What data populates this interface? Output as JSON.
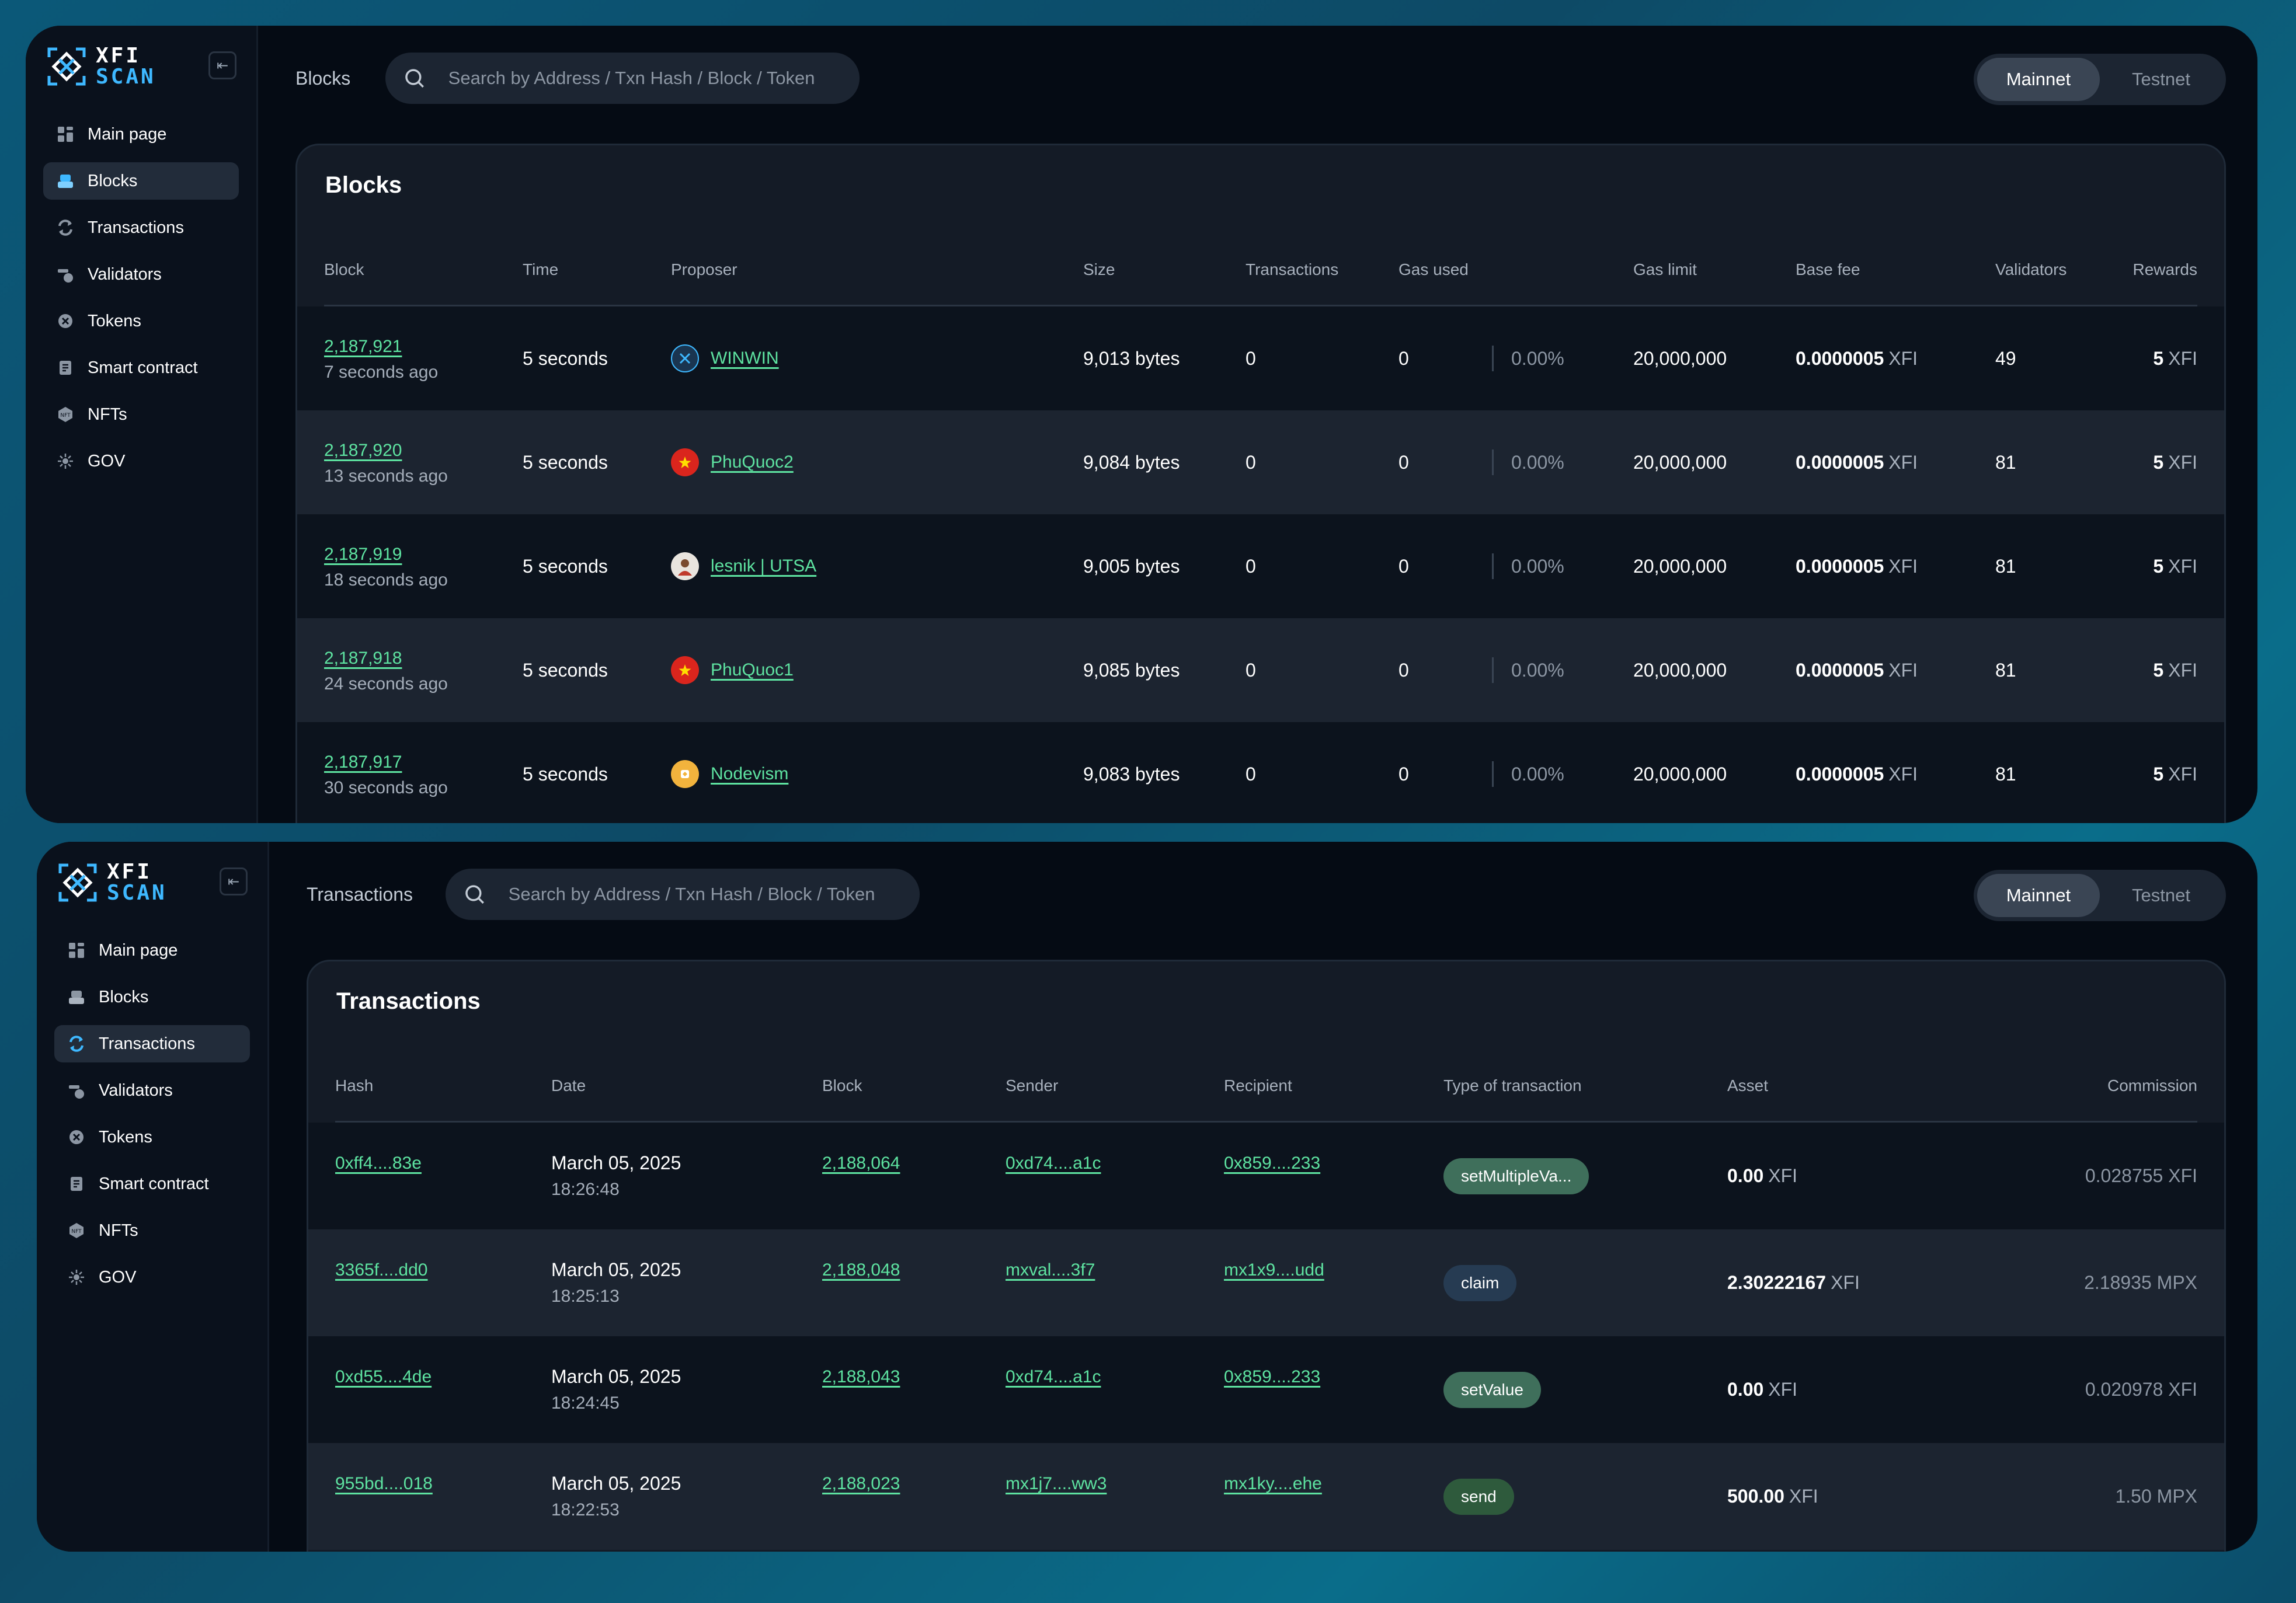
{
  "brand": {
    "line1": "XFI",
    "line2": "SCAN",
    "accent": "#3eb8ff",
    "link_color": "#5ee3a1"
  },
  "sidebar": {
    "items": [
      {
        "label": "Main page",
        "icon": "dashboard-icon"
      },
      {
        "label": "Blocks",
        "icon": "blocks-icon"
      },
      {
        "label": "Transactions",
        "icon": "transactions-icon"
      },
      {
        "label": "Validators",
        "icon": "validators-icon"
      },
      {
        "label": "Tokens",
        "icon": "tokens-icon"
      },
      {
        "label": "Smart contract",
        "icon": "contract-icon"
      },
      {
        "label": "NFTs",
        "icon": "nft-icon"
      },
      {
        "label": "GOV",
        "icon": "gov-icon"
      }
    ]
  },
  "search": {
    "placeholder": "Search by Address / Txn Hash / Block / Token"
  },
  "network": {
    "mainnet": "Mainnet",
    "testnet": "Testnet",
    "selected": "Mainnet"
  },
  "blocks_page": {
    "crumb": "Blocks",
    "title": "Blocks",
    "columns": [
      "Block",
      "Time",
      "Proposer",
      "Size",
      "Transactions",
      "Gas used",
      "Gas limit",
      "Base fee",
      "Validators",
      "Rewards"
    ],
    "rows": [
      {
        "block": "2,187,921",
        "ago": "7 seconds ago",
        "time": "5 seconds",
        "proposer": "WINWIN",
        "size": "9,013 bytes",
        "txs": "0",
        "gas_used": "0",
        "gas_pct": "0.00%",
        "gas_limit": "20,000,000",
        "base_fee": "0.0000005",
        "fee_unit": "XFI",
        "validators": "49",
        "reward": "5",
        "reward_unit": "XFI"
      },
      {
        "block": "2,187,920",
        "ago": "13 seconds ago",
        "time": "5 seconds",
        "proposer": "PhuQuoc2",
        "size": "9,084 bytes",
        "txs": "0",
        "gas_used": "0",
        "gas_pct": "0.00%",
        "gas_limit": "20,000,000",
        "base_fee": "0.0000005",
        "fee_unit": "XFI",
        "validators": "81",
        "reward": "5",
        "reward_unit": "XFI"
      },
      {
        "block": "2,187,919",
        "ago": "18 seconds ago",
        "time": "5 seconds",
        "proposer": "lesnik | UTSA",
        "size": "9,005 bytes",
        "txs": "0",
        "gas_used": "0",
        "gas_pct": "0.00%",
        "gas_limit": "20,000,000",
        "base_fee": "0.0000005",
        "fee_unit": "XFI",
        "validators": "81",
        "reward": "5",
        "reward_unit": "XFI"
      },
      {
        "block": "2,187,918",
        "ago": "24 seconds ago",
        "time": "5 seconds",
        "proposer": "PhuQuoc1",
        "size": "9,085 bytes",
        "txs": "0",
        "gas_used": "0",
        "gas_pct": "0.00%",
        "gas_limit": "20,000,000",
        "base_fee": "0.0000005",
        "fee_unit": "XFI",
        "validators": "81",
        "reward": "5",
        "reward_unit": "XFI"
      },
      {
        "block": "2,187,917",
        "ago": "30 seconds ago",
        "time": "5 seconds",
        "proposer": "Nodevism",
        "size": "9,083 bytes",
        "txs": "0",
        "gas_used": "0",
        "gas_pct": "0.00%",
        "gas_limit": "20,000,000",
        "base_fee": "0.0000005",
        "fee_unit": "XFI",
        "validators": "81",
        "reward": "5",
        "reward_unit": "XFI"
      }
    ]
  },
  "transactions_page": {
    "crumb": "Transactions",
    "title": "Transactions",
    "columns": [
      "Hash",
      "Date",
      "Block",
      "Sender",
      "Recipient",
      "Type of transaction",
      "Asset",
      "Commission"
    ],
    "rows": [
      {
        "hash": "0xff4....83e",
        "date": "March 05, 2025",
        "clock": "18:26:48",
        "block": "2,188,064",
        "sender": "0xd74....a1c",
        "recipient": "0x859....233",
        "type": "setMultipleVa...",
        "asset": "0.00",
        "asset_unit": "XFI",
        "commission": "0.028755 XFI"
      },
      {
        "hash": "3365f....dd0",
        "date": "March 05, 2025",
        "clock": "18:25:13",
        "block": "2,188,048",
        "sender": "mxval....3f7",
        "recipient": "mx1x9....udd",
        "type": "claim",
        "asset": "2.30222167",
        "asset_unit": "XFI",
        "commission": "2.18935 MPX"
      },
      {
        "hash": "0xd55....4de",
        "date": "March 05, 2025",
        "clock": "18:24:45",
        "block": "2,188,043",
        "sender": "0xd74....a1c",
        "recipient": "0x859....233",
        "type": "setValue",
        "asset": "0.00",
        "asset_unit": "XFI",
        "commission": "0.020978 XFI"
      },
      {
        "hash": "955bd....018",
        "date": "March 05, 2025",
        "clock": "18:22:53",
        "block": "2,188,023",
        "sender": "mx1j7....ww3",
        "recipient": "mx1ky....ehe",
        "type": "send",
        "asset": "500.00",
        "asset_unit": "XFI",
        "commission": "1.50 MPX"
      }
    ]
  }
}
